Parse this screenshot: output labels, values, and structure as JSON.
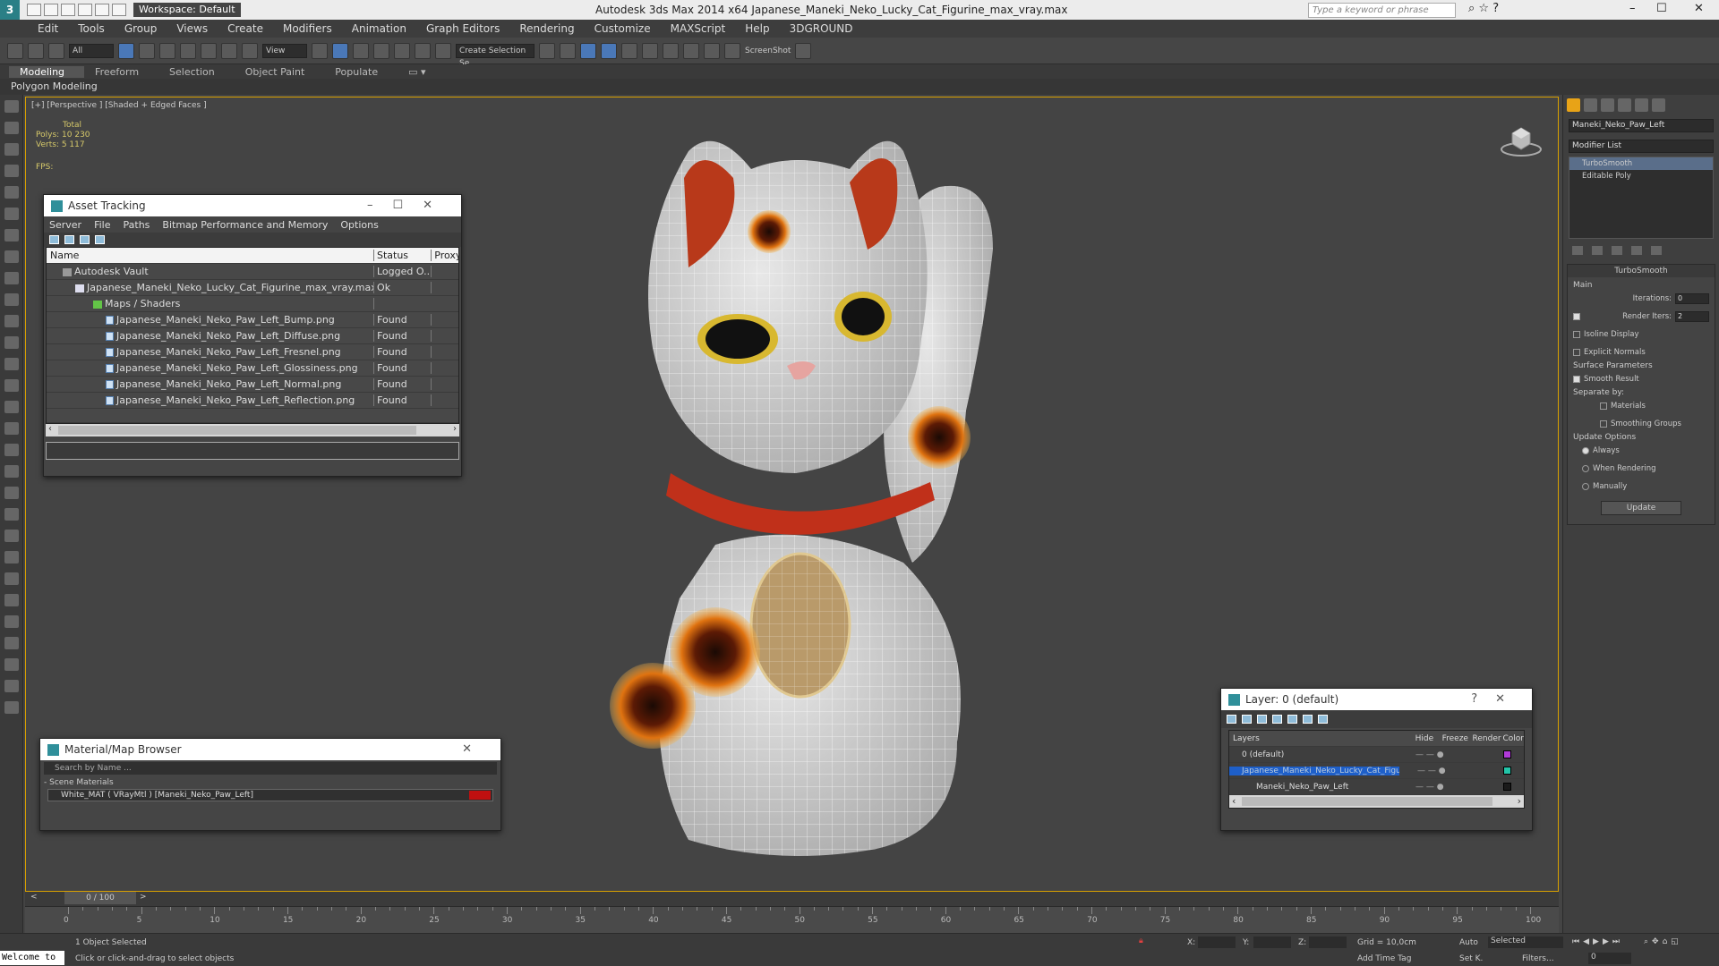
{
  "titlebar": {
    "workspace": "Workspace: Default",
    "app_title": "Autodesk 3ds Max  2014 x64    Japanese_Maneki_Neko_Lucky_Cat_Figurine_max_vray.max",
    "search_placeholder": "Type a keyword or phrase"
  },
  "menu": [
    "Edit",
    "Tools",
    "Group",
    "Views",
    "Create",
    "Modifiers",
    "Animation",
    "Graph Editors",
    "Rendering",
    "Customize",
    "MAXScript",
    "Help",
    "3DGROUND"
  ],
  "toolbar": {
    "filter": "All",
    "refcoord": "View",
    "selection_set": "Create Selection Se",
    "screenshot": "ScreenShot"
  },
  "ribbon": {
    "tabs": [
      "Modeling",
      "Freeform",
      "Selection",
      "Object Paint",
      "Populate"
    ],
    "sub": "Polygon Modeling"
  },
  "viewport": {
    "label": "[+] [Perspective ] [Shaded + Edged Faces ]",
    "stats_total": "Total",
    "polys_label": "Polys:",
    "polys": "10 230",
    "verts_label": "Verts:",
    "verts": "5 117",
    "fps": "FPS:"
  },
  "asset_tracking": {
    "title": "Asset Tracking",
    "menu": [
      "Server",
      "File",
      "Paths",
      "Bitmap Performance and Memory",
      "Options"
    ],
    "columns": [
      "Name",
      "Status",
      "Proxy"
    ],
    "rows": [
      {
        "name": "Autodesk Vault",
        "status": "Logged O..."
      },
      {
        "name": "Japanese_Maneki_Neko_Lucky_Cat_Figurine_max_vray.max",
        "status": "Ok"
      },
      {
        "name": "Maps / Shaders",
        "status": ""
      },
      {
        "name": "Japanese_Maneki_Neko_Paw_Left_Bump.png",
        "status": "Found"
      },
      {
        "name": "Japanese_Maneki_Neko_Paw_Left_Diffuse.png",
        "status": "Found"
      },
      {
        "name": "Japanese_Maneki_Neko_Paw_Left_Fresnel.png",
        "status": "Found"
      },
      {
        "name": "Japanese_Maneki_Neko_Paw_Left_Glossiness.png",
        "status": "Found"
      },
      {
        "name": "Japanese_Maneki_Neko_Paw_Left_Normal.png",
        "status": "Found"
      },
      {
        "name": "Japanese_Maneki_Neko_Paw_Left_Reflection.png",
        "status": "Found"
      }
    ]
  },
  "material_browser": {
    "title": "Material/Map Browser",
    "search_placeholder": "Search by Name ...",
    "section": "- Scene Materials",
    "item": "White_MAT  ( VRayMtl )  [Maneki_Neko_Paw_Left]"
  },
  "layer_panel": {
    "title": "Layer: 0 (default)",
    "columns": [
      "Layers",
      "Hide",
      "Freeze",
      "Render",
      "Color"
    ],
    "rows": [
      {
        "name": "0 (default)",
        "color": "#b03ad8"
      },
      {
        "name": "Japanese_Maneki_Neko_Lucky_Cat_Figurine",
        "color": "#23c4a8"
      },
      {
        "name": "Maneki_Neko_Paw_Left",
        "color": "#1a1a1a"
      }
    ]
  },
  "command_panel": {
    "object_name": "Maneki_Neko_Paw_Left",
    "modifier_list": "Modifier List",
    "stack": [
      "TurboSmooth",
      "Editable Poly"
    ],
    "turbosmooth": {
      "title": "TurboSmooth",
      "main": "Main",
      "iterations_label": "Iterations:",
      "iterations": "0",
      "render_iters_label": "Render Iters:",
      "render_iters": "2",
      "isoline": "Isoline Display",
      "explicit": "Explicit Normals",
      "surface": "Surface Parameters",
      "smooth_result": "Smooth Result",
      "separate_by": "Separate by:",
      "materials": "Materials",
      "smoothing_groups": "Smoothing Groups",
      "update_options": "Update Options",
      "always": "Always",
      "when_rendering": "When Rendering",
      "manually": "Manually",
      "update": "Update"
    }
  },
  "timeline": {
    "frame": "0 / 100",
    "ticks": [
      "0",
      "5",
      "10",
      "15",
      "20",
      "25",
      "30",
      "35",
      "40",
      "45",
      "50",
      "55",
      "60",
      "65",
      "70",
      "75",
      "80",
      "85",
      "90",
      "95",
      "100"
    ]
  },
  "status": {
    "maxscript": "Welcome to",
    "selected": "1 Object Selected",
    "hint": "Click or click-and-drag to select objects",
    "x": "X:",
    "y": "Y:",
    "z": "Z:",
    "grid": "Grid = 10,0cm",
    "add_time_tag": "Add Time Tag",
    "auto": "Auto",
    "set_k": "Set K.",
    "selected_dd": "Selected",
    "filters": "Filters...",
    "frame_field": "0"
  }
}
